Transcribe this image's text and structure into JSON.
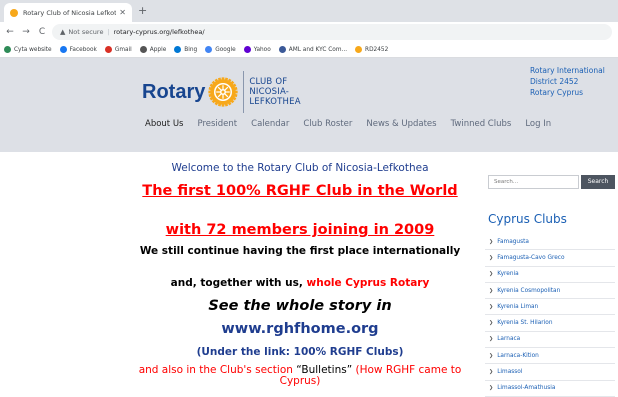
{
  "browser": {
    "tab_title": "Rotary Club of Nicosia Lefkothea",
    "new_tab": "+",
    "nav": {
      "back": "←",
      "forward": "→",
      "reload": "C",
      "home": "⌂"
    },
    "not_secure": "Not secure",
    "url": "rotary-cyprus.org/lefkothea/",
    "bookmarks": [
      {
        "label": "Cyta website",
        "color": "#2e8b57"
      },
      {
        "label": "Facebook",
        "color": "#1877f2"
      },
      {
        "label": "Gmail",
        "color": "#d93025"
      },
      {
        "label": "Apple",
        "color": "#555555"
      },
      {
        "label": "Bing",
        "color": "#0078d4"
      },
      {
        "label": "Google",
        "color": "#4285f4"
      },
      {
        "label": "Yahoo",
        "color": "#6001d2"
      },
      {
        "label": "AML and KYC Com...",
        "color": "#3b5998"
      },
      {
        "label": "RD2452",
        "color": "#f7a81b"
      }
    ]
  },
  "header": {
    "logo_word": "Rotary",
    "club_lines": [
      "CLUB OF",
      "NICOSIA-",
      "LEFKOTHEA"
    ],
    "district_lines": [
      "Rotary International",
      "District 2452",
      "Rotary Cyprus"
    ],
    "nav": [
      "About Us",
      "President",
      "Calendar",
      "Club Roster",
      "News & Updates",
      "Twinned Clubs",
      "Log In"
    ],
    "colors": {
      "brand_blue": "#17458f",
      "brand_gold": "#f7a81b"
    }
  },
  "main": {
    "welcome": "Welcome to the Rotary Club of Nicosia-Lefkothea",
    "headline_1": "The first 100% RGHF Club in the World",
    "headline_2": "with 72 members joining in 2009",
    "still": "We still continue having the first place internationally",
    "together_prefix": "and, together with us, ",
    "together_red": "whole Cyprus Rotary",
    "story": "See the whole story in",
    "site": "www.rghfhome.org",
    "under_link": "(Under the link: 100% RGHF Clubs)",
    "bulletins_prefix": "and also in the Club's section ",
    "bulletins_quote": "“Bulletins”",
    "bulletins_suffix": " (How RGHF came to Cyprus)"
  },
  "sidebar": {
    "search_placeholder": "Search...",
    "search_button": "Search",
    "clubs_title": "Cyprus Clubs",
    "clubs": [
      "Famagusta",
      "Famagusta-Cavo Greco",
      "Kyrenia",
      "Kyrenia Cosmopolitan",
      "Kyrenia Liman",
      "Kyrenia St. Hilarion",
      "Larnaca",
      "Larnaca-Kition",
      "Limassol",
      "Limassol-Amathusia"
    ]
  }
}
